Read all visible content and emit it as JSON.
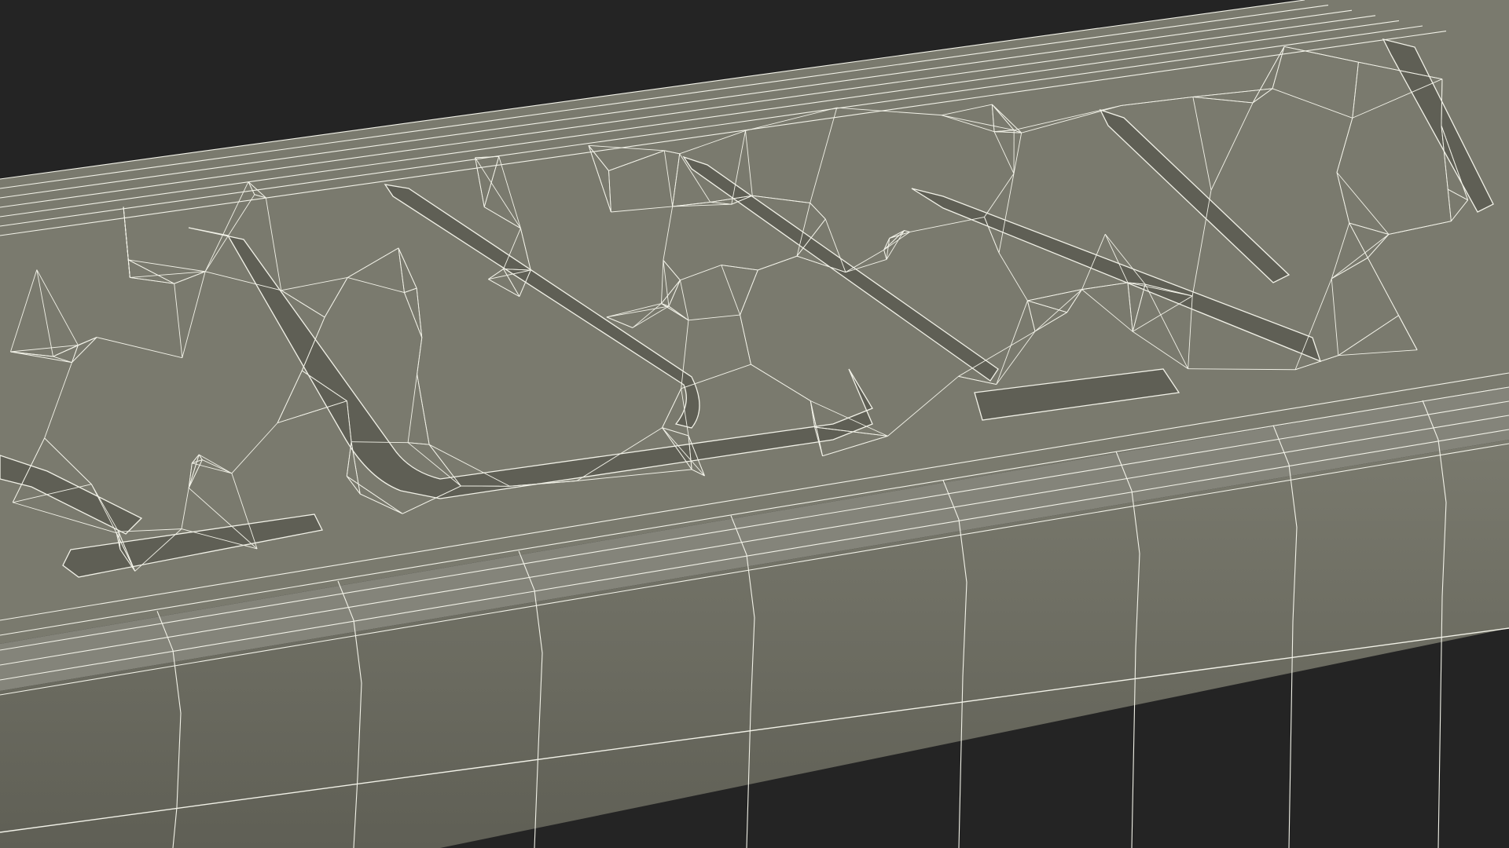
{
  "scene": {
    "subject": "wireframe-mesh",
    "colors": {
      "background": "#242424",
      "surface": "#7a7a6e",
      "surface_dark": "#5f5f55",
      "surface_light": "#84847a",
      "wire": "#f2f2e8",
      "recess_shadow": "#4a4a42"
    }
  }
}
